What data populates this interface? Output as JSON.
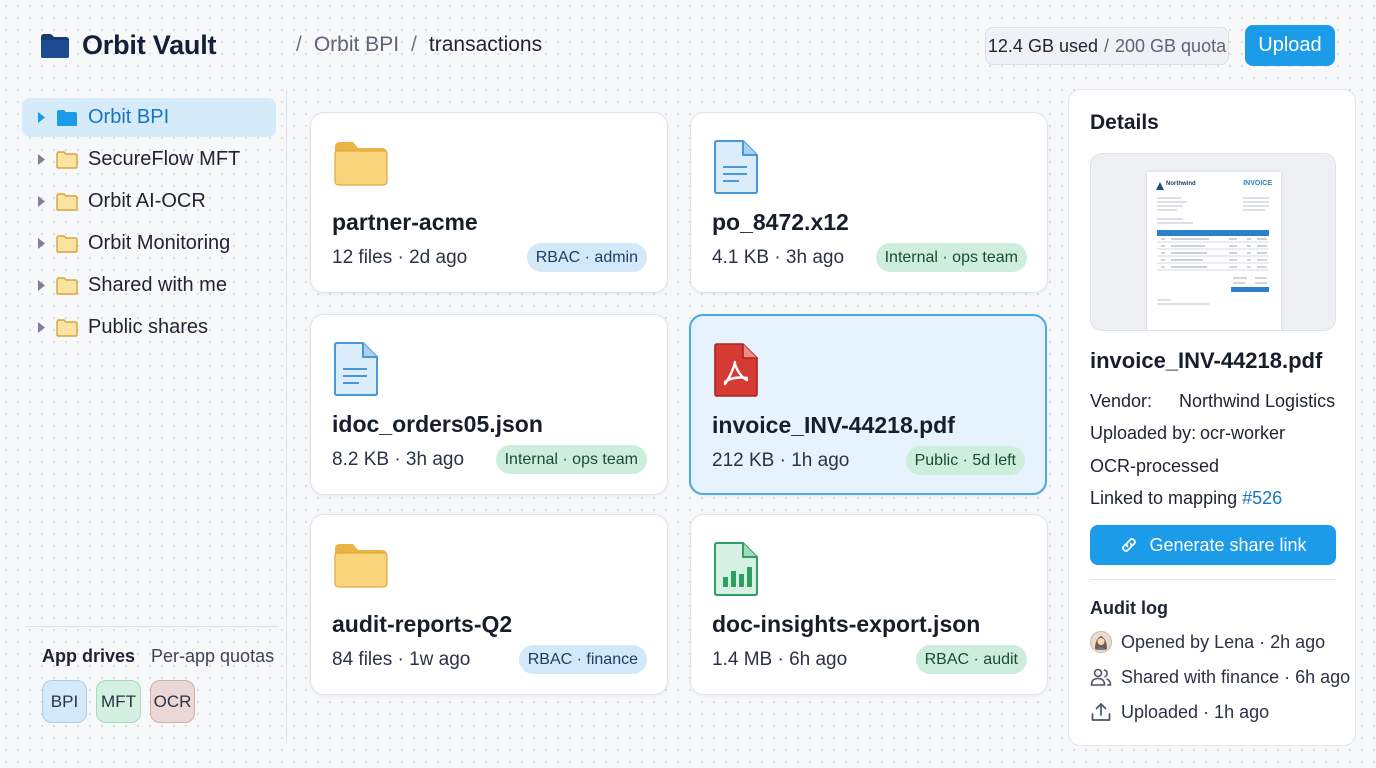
{
  "app": {
    "name": "Orbit Vault"
  },
  "breadcrumb": {
    "sep1": "/",
    "parent": "Orbit BPI",
    "sep2": "/",
    "current": "transactions"
  },
  "quota": {
    "used": "12.4 GB used",
    "separator": "/",
    "total": "200 GB quota"
  },
  "toolbar": {
    "upload_label": "Upload"
  },
  "sidebar": {
    "items": [
      {
        "label": "Orbit BPI",
        "active": true
      },
      {
        "label": "SecureFlow MFT"
      },
      {
        "label": "Orbit AI-OCR"
      },
      {
        "label": "Orbit Monitoring"
      },
      {
        "label": "Shared with me"
      },
      {
        "label": "Public shares"
      }
    ],
    "drives_title": "App drives",
    "drives_subtitle": "Per-app quotas",
    "drives": [
      {
        "label": "BPI"
      },
      {
        "label": "MFT"
      },
      {
        "label": "OCR"
      }
    ]
  },
  "files": [
    {
      "name": "partner-acme",
      "meta": "12 files · 2d ago",
      "badge": "RBAC · admin",
      "icon": "folder-icon"
    },
    {
      "name": "po_8472.x12",
      "meta": "4.1 KB · 3h ago",
      "badge": "Internal · ops team",
      "icon": "document-icon"
    },
    {
      "name": "idoc_orders05.json",
      "meta": "8.2 KB · 3h ago",
      "badge": "Internal · ops team",
      "icon": "document-icon"
    },
    {
      "name": "invoice_INV-44218.pdf",
      "meta": "212 KB · 1h ago",
      "badge": "Public · 5d left",
      "icon": "pdf-icon",
      "selected": true
    },
    {
      "name": "audit-reports-Q2",
      "meta": "84 files · 1w ago",
      "badge": "RBAC · finance",
      "icon": "folder-icon"
    },
    {
      "name": "doc-insights-export.json",
      "meta": "1.4 MB · 6h ago",
      "badge": "RBAC · audit",
      "icon": "spreadsheet-chart-icon"
    }
  ],
  "details": {
    "title": "Details",
    "preview": {
      "brand": "Northwind",
      "doc_label": "INVOICE"
    },
    "filename": "invoice_INV-44218.pdf",
    "vendor_label": "Vendor:",
    "vendor_value": "Northwind Logistics",
    "uploaded_label": "Uploaded by:",
    "uploaded_value": "ocr-worker",
    "status": "OCR-processed",
    "mapping_label": "Linked to mapping",
    "mapping_link": "#526",
    "share_label": "Generate share link",
    "audit_title": "Audit log",
    "audit": [
      {
        "text": "Opened by Lena · 2h ago",
        "icon": "avatar"
      },
      {
        "text": "Shared with finance · 6h ago",
        "icon": "users-icon"
      },
      {
        "text": "Uploaded · 1h ago",
        "icon": "upload-icon"
      }
    ]
  },
  "colors": {
    "accent": "#1b9be8",
    "folder": "#f5cd68",
    "pdf": "#d63b33",
    "document": "#4a97d6",
    "spreadsheet": "#2f9e63"
  }
}
